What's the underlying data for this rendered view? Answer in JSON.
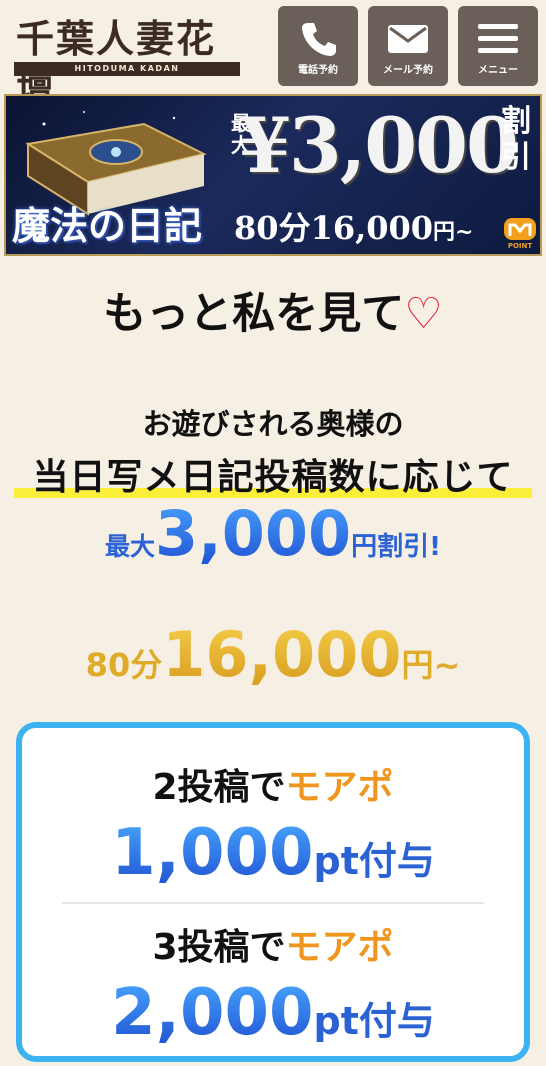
{
  "header": {
    "logo": {
      "title": "千葉人妻花壇",
      "subtitle": "HITODUMA KADAN"
    },
    "buttons": [
      {
        "icon": "phone-icon",
        "label": "電話予約"
      },
      {
        "icon": "mail-icon",
        "label": "メール予約"
      },
      {
        "icon": "menu-icon",
        "label": "メニュー"
      }
    ]
  },
  "banner": {
    "max_label": "最大",
    "amount": "¥3,000",
    "waribiki": "割引",
    "title": "魔法の日記",
    "price_duration": "80分",
    "price_amount": "16,000",
    "price_suffix": "円~",
    "badge": "POINT"
  },
  "main": {
    "headline": "もっと私を見て",
    "headline_heart": "♡",
    "sub1": "お遊びされる奥様の",
    "sub2": "当日写メ日記投稿数に応じて",
    "discount": {
      "prefix": "最大",
      "amount": "3,000",
      "suffix": "円割引!"
    },
    "price": {
      "prefix": "80分",
      "amount": "16,000",
      "suffix": "円~"
    }
  },
  "tiers": [
    {
      "count": "2投稿で",
      "label": "モアポ",
      "points": "1,000",
      "unit": "pt付与"
    },
    {
      "count": "3投稿で",
      "label": "モアポ",
      "points": "2,000",
      "unit": "pt付与"
    }
  ],
  "colors": {
    "background": "#f6efe4",
    "header_button": "#6a5f59",
    "accent_blue": "#2b63d6",
    "accent_gold": "#e0ab28",
    "accent_orange": "#f0961e",
    "card_border": "#3cb3f0",
    "highlight_yellow": "#fbef3a",
    "heart_red": "#e0253b"
  }
}
